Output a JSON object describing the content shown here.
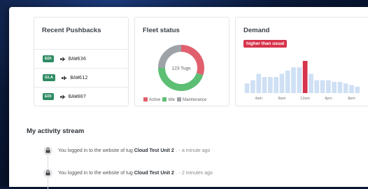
{
  "pushbacks": {
    "title": "Recent Pushbacks",
    "items": [
      {
        "badge": "EDI",
        "flight": "BAW636"
      },
      {
        "badge": "GLA",
        "flight": "BAW612"
      },
      {
        "badge": "EDI",
        "flight": "BAW007"
      }
    ]
  },
  "fleet": {
    "title": "Fleet status",
    "center_label": "123 Tugs",
    "legend": [
      {
        "label": "Active",
        "color": "#e0606d"
      },
      {
        "label": "Idle",
        "color": "#5cbf73"
      },
      {
        "label": "Maintenance",
        "color": "#9ea3a8"
      }
    ]
  },
  "demand": {
    "title": "Demand",
    "tag": "higher than usual"
  },
  "activity": {
    "title": "My activity stream",
    "items": [
      {
        "prefix": "You logged in to the website of tug",
        "tug": "Cloud Test Unit 2",
        "time": ". - a minute ago"
      },
      {
        "prefix": "You logged in to the website of tug",
        "tug": "Cloud Test Unit 2",
        "time": ". - 2 minutes ago"
      }
    ]
  },
  "chart_data": [
    {
      "type": "pie",
      "title": "Fleet status",
      "categories": [
        "Active",
        "Idle",
        "Maintenance"
      ],
      "values": [
        30,
        45,
        25
      ],
      "colors": [
        "#e0606d",
        "#5cbf73",
        "#9ea3a8"
      ],
      "center_label": "123 Tugs"
    },
    {
      "type": "bar",
      "title": "Demand",
      "x_tick_labels": [
        "4am",
        "8am",
        "12am",
        "4pm",
        "8pm"
      ],
      "values": [
        3,
        4,
        6,
        5,
        5,
        5,
        6,
        7,
        8,
        8,
        10,
        6,
        4,
        4,
        4,
        3.5,
        3.5,
        3,
        2.5,
        2
      ],
      "highlight_index": 10,
      "bar_color": "#cfe0f5",
      "highlight_color": "#d6344b"
    }
  ]
}
